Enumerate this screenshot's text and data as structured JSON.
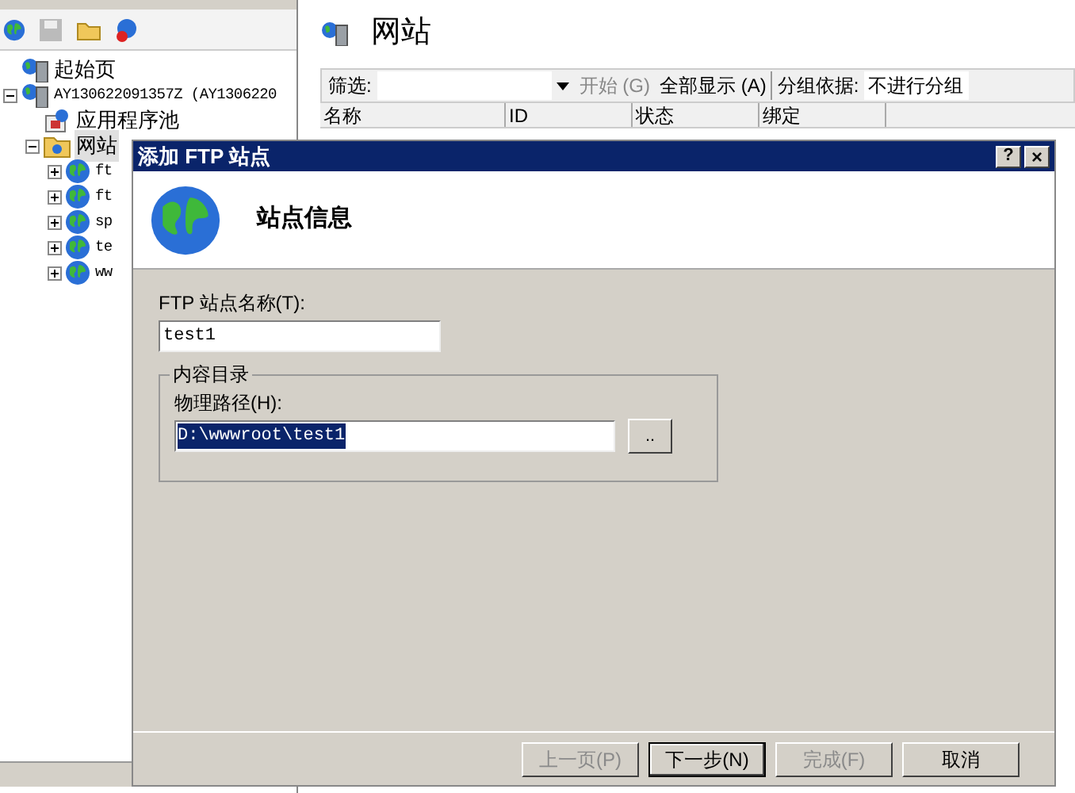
{
  "tree": [
    {
      "label": "起始页",
      "kind": "start",
      "selected": false
    },
    {
      "label": "AY130622091357Z (AY1306220",
      "kind": "server",
      "expanded": true,
      "selected": false,
      "children": [
        {
          "label": "应用程序池",
          "kind": "pool",
          "selected": false
        },
        {
          "label": "网站",
          "kind": "sites",
          "expanded": true,
          "selected": true,
          "children": [
            {
              "label": "ft",
              "kind": "site",
              "expanded": false,
              "selected": false
            },
            {
              "label": "ft",
              "kind": "site",
              "expanded": false,
              "selected": false
            },
            {
              "label": "sp",
              "kind": "site",
              "expanded": false,
              "selected": false
            },
            {
              "label": "te",
              "kind": "site",
              "expanded": false,
              "selected": false
            },
            {
              "label": "ww",
              "kind": "site",
              "expanded": false,
              "selected": false
            }
          ]
        }
      ]
    }
  ],
  "content": {
    "title": "网站",
    "filter_label": "筛选:",
    "start": "开始 (G)",
    "show_all": "全部显示 (A)",
    "group_label": "分组依据:",
    "group_value": "不进行分组",
    "columns": [
      "名称",
      "ID",
      "状态",
      "绑定"
    ]
  },
  "dialog": {
    "title": "添加 FTP 站点",
    "help": "?",
    "close": "×",
    "header": "站点信息",
    "name_label": "FTP 站点名称(T):",
    "name_value": "test1",
    "group_title": "内容目录",
    "path_label": "物理路径(H):",
    "path_value": "D:\\wwwroot\\test1",
    "browse": "..",
    "buttons": [
      {
        "label": "上一页(P)",
        "disabled": true,
        "default": false
      },
      {
        "label": "下一步(N)",
        "disabled": false,
        "default": true
      },
      {
        "label": "完成(F)",
        "disabled": true,
        "default": false
      },
      {
        "label": "取消",
        "disabled": false,
        "default": false
      }
    ]
  }
}
